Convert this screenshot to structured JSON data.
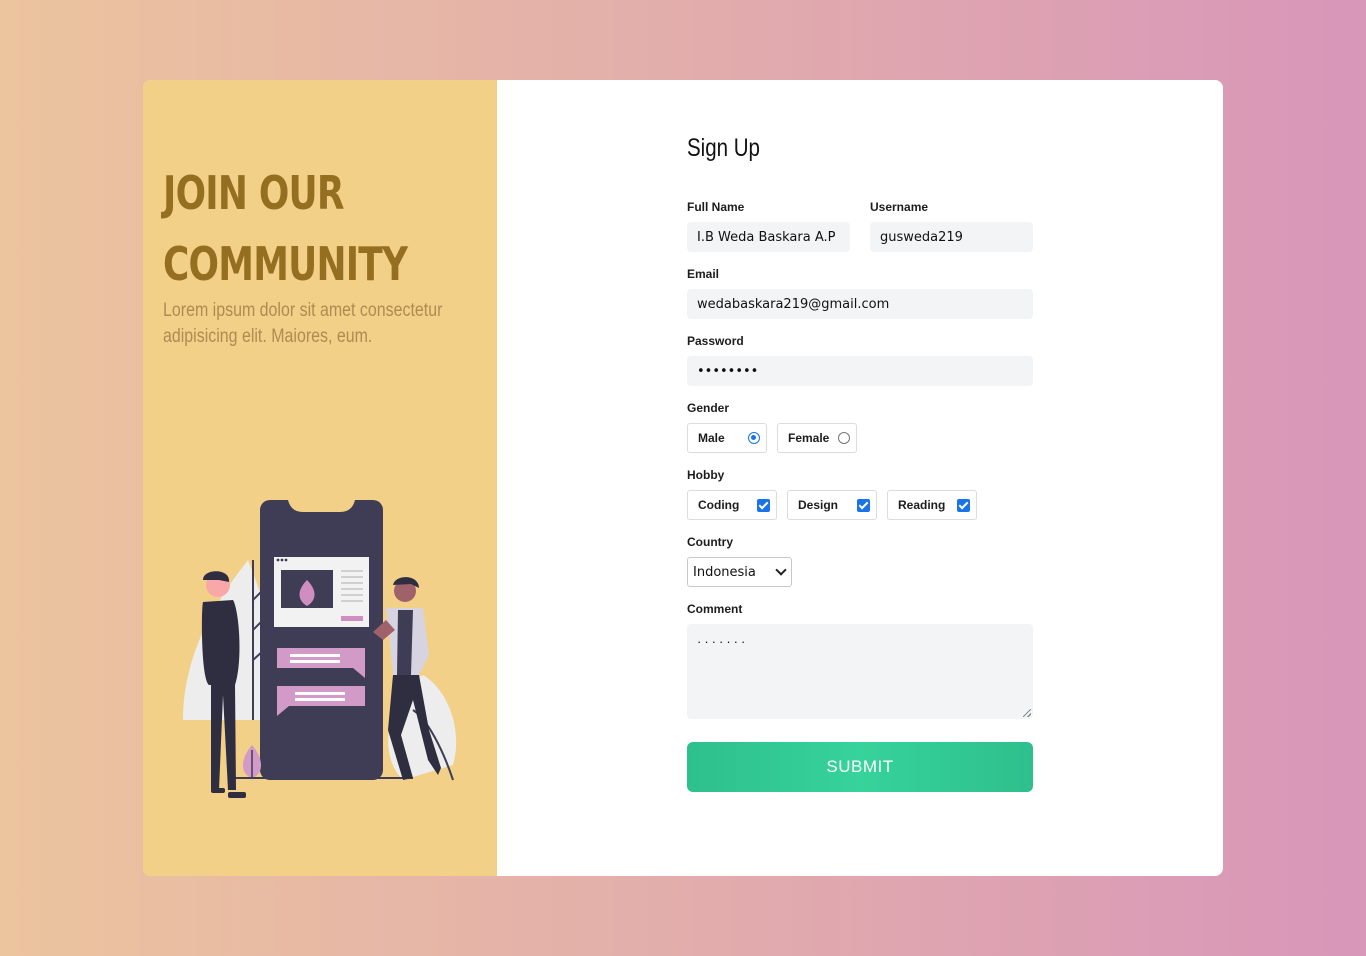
{
  "promo": {
    "headline_line1": "JOIN OUR",
    "headline_line2": "COMMUNITY",
    "subtitle": "Lorem ipsum dolor sit amet consectetur adipisicing elit. Maiores, eum."
  },
  "form": {
    "title": "Sign Up",
    "full_name": {
      "label": "Full Name",
      "value": "I.B Weda Baskara A.P"
    },
    "username": {
      "label": "Username",
      "value": "gusweda219"
    },
    "email": {
      "label": "Email",
      "value": "wedabaskara219@gmail.com"
    },
    "password": {
      "label": "Password",
      "value": "••••••••"
    },
    "gender": {
      "label": "Gender",
      "options": [
        {
          "label": "Male",
          "selected": true
        },
        {
          "label": "Female",
          "selected": false
        }
      ]
    },
    "hobby": {
      "label": "Hobby",
      "options": [
        {
          "label": "Coding",
          "checked": true
        },
        {
          "label": "Design",
          "checked": true
        },
        {
          "label": "Reading",
          "checked": true
        }
      ]
    },
    "country": {
      "label": "Country",
      "selected": "Indonesia"
    },
    "comment": {
      "label": "Comment",
      "value": "·······"
    },
    "submit_label": "SUBMIT"
  },
  "colors": {
    "accent": "#1a73e8",
    "submit": "#33c996",
    "promo_bg": "#f3d088",
    "headline": "#946f21"
  }
}
